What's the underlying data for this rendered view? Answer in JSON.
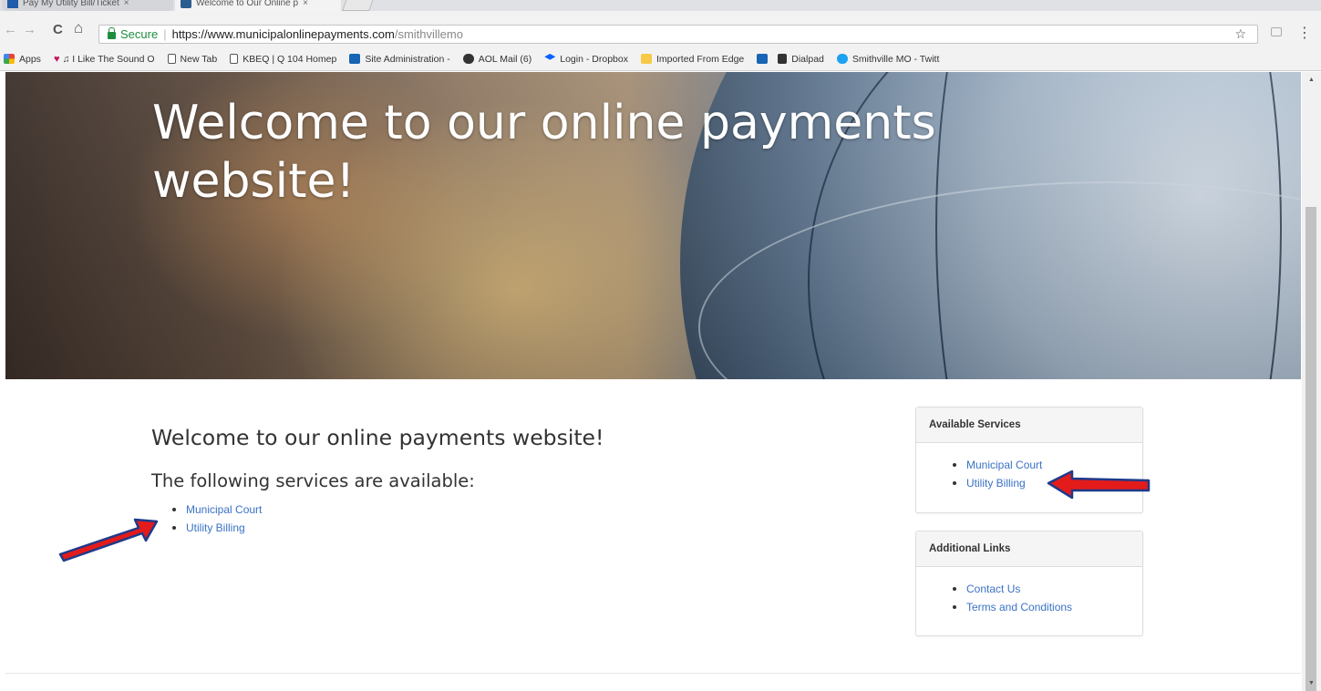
{
  "browser": {
    "tabs": [
      {
        "title": "Pay My Utility Bill/Ticket",
        "close": "×"
      },
      {
        "title": "Welcome to Our Online p",
        "close": "×"
      }
    ],
    "nav": {
      "back": "←",
      "forward": "→",
      "reload": "C",
      "home": "⌂"
    },
    "address": {
      "security_label": "Secure",
      "separator": "|",
      "url_scheme_host": "https://www.municipalonlinepayments.com",
      "url_path": "/smithvillemo"
    },
    "bookmark_star": "☆",
    "menu": "⋮",
    "bookmarks": [
      {
        "label": "Apps",
        "icon": "apps-grid-icon"
      },
      {
        "label": "♫ I Like The Sound O",
        "icon": "iheart-icon"
      },
      {
        "label": "New Tab",
        "icon": "page-icon"
      },
      {
        "label": "KBEQ | Q 104 Homep",
        "icon": "page-icon"
      },
      {
        "label": "Site Administration -",
        "icon": "site-admin-icon"
      },
      {
        "label": "AOL Mail (6)",
        "icon": "aol-icon"
      },
      {
        "label": "Login - Dropbox",
        "icon": "dropbox-icon"
      },
      {
        "label": "Imported From Edge",
        "icon": "folder-icon"
      },
      {
        "label": "",
        "icon": "site-admin-icon"
      },
      {
        "label": "Dialpad",
        "icon": "dialpad-icon"
      },
      {
        "label": "Smithville MO - Twitt",
        "icon": "twitter-icon"
      }
    ]
  },
  "hero": {
    "title": "Welcome to our online payments website!"
  },
  "main": {
    "heading": "Welcome to our online payments website!",
    "subheading": "The following services are available:",
    "services": [
      "Municipal Court",
      "Utility Billing"
    ]
  },
  "sidebar": {
    "available_services": {
      "title": "Available Services",
      "items": [
        "Municipal Court",
        "Utility Billing"
      ]
    },
    "additional_links": {
      "title": "Additional Links",
      "items": [
        "Contact Us",
        "Terms and Conditions"
      ]
    }
  },
  "scrollbar": {
    "up": "▲",
    "down": "▼"
  },
  "colors": {
    "link": "#3a72c4",
    "secure": "#1e8e3e",
    "arrow_fill": "#e31b1b",
    "arrow_stroke": "#1f3a8a"
  }
}
